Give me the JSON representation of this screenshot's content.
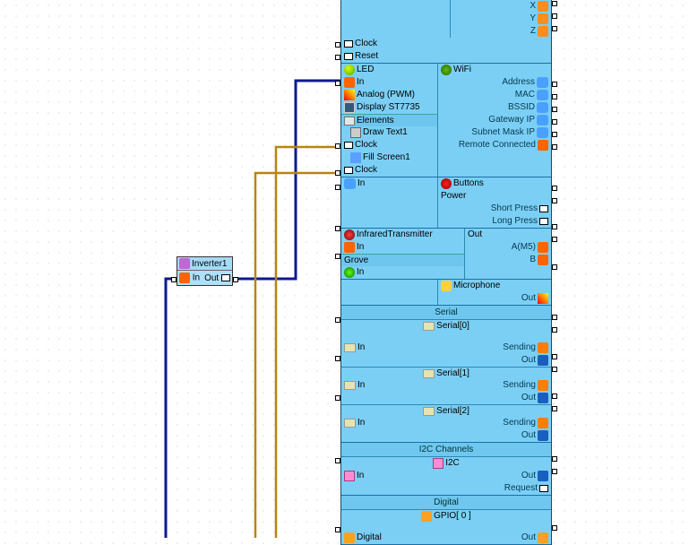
{
  "inverter": {
    "title": "Inverter1",
    "pin_in": "In",
    "pin_out": "Out"
  },
  "partial_top": {
    "x": "X",
    "y": "Y",
    "z": "Z",
    "clock": "Clock",
    "reset": "Reset"
  },
  "display_block": {
    "led": "LED",
    "in1": "In",
    "analog": "Analog (PWM)",
    "display": "Display ST7735",
    "elements": "Elements",
    "draw": "Draw Text1",
    "clock1": "Clock",
    "fill": "Fill Screen1",
    "clock2": "Clock"
  },
  "ir_block": {
    "in_top": "In",
    "ir": "InfraredTransmitter",
    "in_ir": "In",
    "grove": "Grove",
    "in_grove": "In",
    "out": "Out",
    "a": "A(M5)",
    "b": "B"
  },
  "wifi_block": {
    "wifi": "WiFi",
    "address": "Address",
    "mac": "MAC",
    "bssid": "BSSID",
    "gateway": "Gateway IP",
    "subnet": "Subnet Mask IP",
    "remote": "Remote Connected"
  },
  "buttons_block": {
    "buttons": "Buttons",
    "power": "Power",
    "short": "Short Press",
    "long": "Long Press"
  },
  "mic_block": {
    "mic": "Microphone",
    "out": "Out"
  },
  "serial_block": {
    "title": "Serial",
    "ser0": "Serial[0]",
    "ser1": "Serial[1]",
    "ser2": "Serial[2]",
    "in": "In",
    "sending": "Sending",
    "out": "Out"
  },
  "i2c_block": {
    "title": "I2C Channels",
    "i2c": "I2C",
    "in": "In",
    "out": "Out",
    "req": "Request"
  },
  "digital_block": {
    "title": "Digital",
    "gpio": "GPIO[ 0 ]",
    "digital": "Digital",
    "out": "Out"
  }
}
